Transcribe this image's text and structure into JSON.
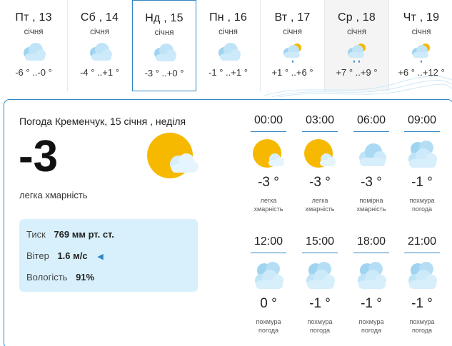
{
  "days": [
    {
      "name": "Пт , 13",
      "month": "січня",
      "temps": "-6 ° ..-0 °",
      "icon": "cloudy-icon"
    },
    {
      "name": "Сб , 14",
      "month": "січня",
      "temps": "-4 ° ..+1 °",
      "icon": "cloudy-icon"
    },
    {
      "name": "Нд , 15",
      "month": "січня",
      "temps": "-3 ° ..+0 °",
      "icon": "cloudy-icon"
    },
    {
      "name": "Пн , 16",
      "month": "січня",
      "temps": "-1 ° ..+1 °",
      "icon": "cloudy-icon"
    },
    {
      "name": "Вт , 17",
      "month": "січня",
      "temps": "+1 ° ..+6 °",
      "icon": "sun-cloud-rain-icon"
    },
    {
      "name": "Ср , 18",
      "month": "січня",
      "temps": "+7 ° ..+9 °",
      "icon": "sun-cloud-rain-icon"
    },
    {
      "name": "Чт , 19",
      "month": "січня",
      "temps": "+6 ° ..+12 °",
      "icon": "sun-cloud-rain-icon"
    }
  ],
  "current": {
    "title": "Погода Кременчук, 15 січня , неділя",
    "temp": "-3",
    "description": "легка хмарність",
    "pressure_label": "Тиск",
    "pressure_value": "769 мм рт. ст.",
    "wind_label": "Вітер",
    "wind_value": "1.6 м/с",
    "humidity_label": "Вологість",
    "humidity_value": "91%"
  },
  "hours": [
    {
      "time": "00:00",
      "temp": "-3 °",
      "desc1": "легка",
      "desc2": "хмарність",
      "icon": "sun-cloud-icon"
    },
    {
      "time": "03:00",
      "temp": "-3 °",
      "desc1": "легка",
      "desc2": "хмарність",
      "icon": "sun-cloud-icon"
    },
    {
      "time": "06:00",
      "temp": "-3 °",
      "desc1": "помірна",
      "desc2": "хмарність",
      "icon": "cloud-icon"
    },
    {
      "time": "09:00",
      "temp": "-1 °",
      "desc1": "похмура",
      "desc2": "погода",
      "icon": "overcast-icon"
    },
    {
      "time": "12:00",
      "temp": "0 °",
      "desc1": "похмура",
      "desc2": "погода",
      "icon": "overcast-icon"
    },
    {
      "time": "15:00",
      "temp": "-1 °",
      "desc1": "похмура",
      "desc2": "погода",
      "icon": "overcast-icon"
    },
    {
      "time": "18:00",
      "temp": "-1 °",
      "desc1": "похмура",
      "desc2": "погода",
      "icon": "overcast-icon"
    },
    {
      "time": "21:00",
      "temp": "-1 °",
      "desc1": "похмура",
      "desc2": "погода",
      "icon": "overcast-icon"
    }
  ],
  "colors": {
    "accent": "#2f86c6",
    "sun": "#f7b800",
    "stats_bg": "#d8f0fb"
  }
}
